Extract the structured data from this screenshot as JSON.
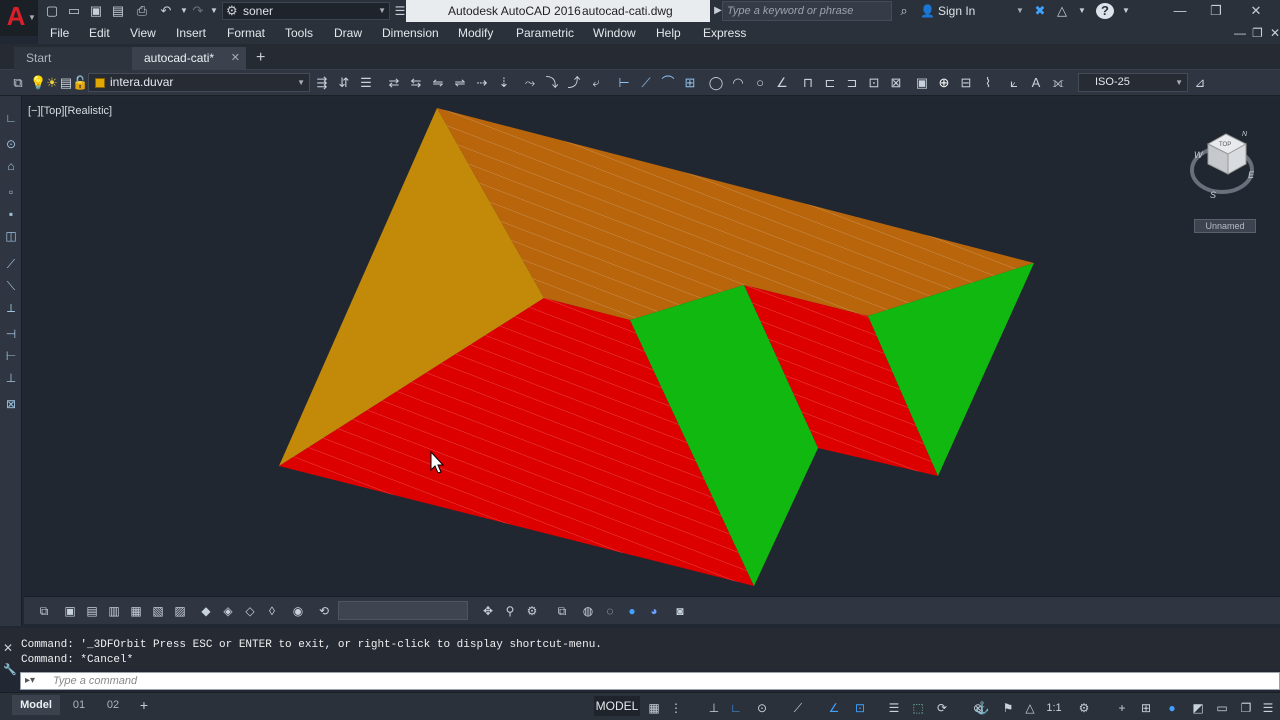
{
  "titlebar": {
    "app_name": "Autodesk AutoCAD 2016",
    "file_name": "autocad-cati.dwg",
    "workspace": "soner",
    "search_placeholder": "Type a keyword or phrase",
    "sign_in": "Sign In"
  },
  "menu": [
    "File",
    "Edit",
    "View",
    "Insert",
    "Format",
    "Tools",
    "Draw",
    "Dimension",
    "Modify",
    "Parametric",
    "Window",
    "Help",
    "Express"
  ],
  "tabs": {
    "start": "Start",
    "document": "autocad-cati*"
  },
  "toolbar": {
    "layer": "intera.duvar",
    "layer_color": "#e0a800",
    "dimstyle": "ISO-25"
  },
  "viewport": {
    "label": "[−][Top][Realistic]",
    "viewcube_top": "TOP",
    "compass": {
      "n": "N",
      "e": "E",
      "s": "S",
      "w": "W"
    },
    "ucs": "Unnamed"
  },
  "command": {
    "history": [
      "Command: '_3DFOrbit Press ESC or ENTER to exit, or right-click to display shortcut-menu.",
      "Command: *Cancel*"
    ],
    "placeholder": "Type a command"
  },
  "status": {
    "layout_tabs": [
      "Model",
      "01",
      "02"
    ],
    "model_label": "MODEL",
    "scale": "1:1"
  },
  "colors": {
    "roof_brown": "#b8650c",
    "roof_orange_gable": "#c38a0a",
    "roof_red": "#dd0000",
    "roof_green": "#10b810",
    "accent_blue": "#3fa2ff"
  }
}
